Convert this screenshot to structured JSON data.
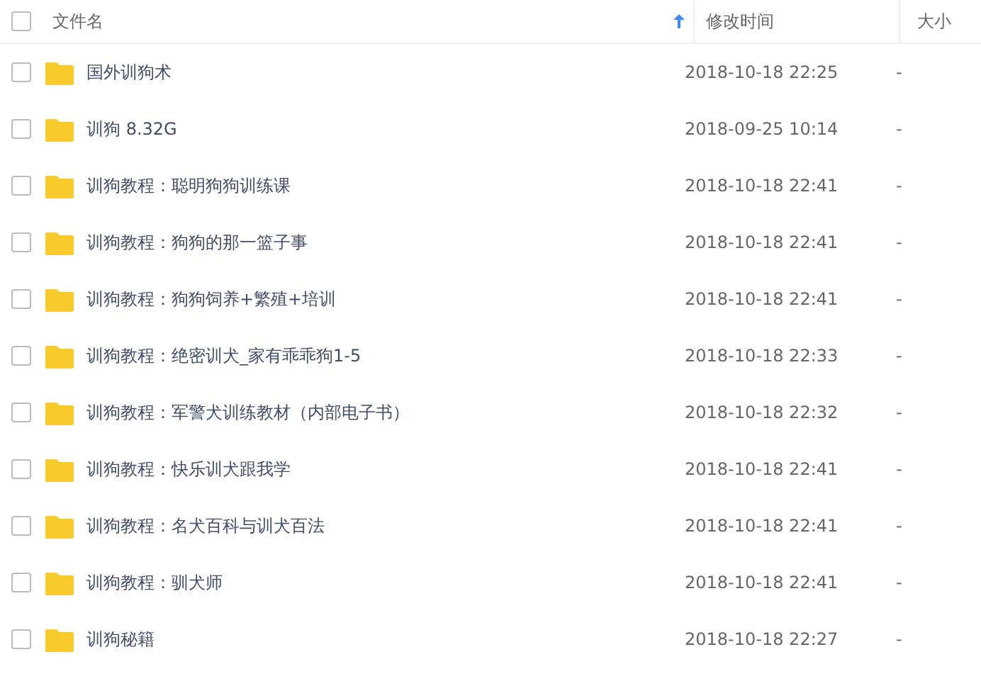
{
  "table": {
    "select_all": {
      "checked": false
    },
    "columns": [
      {
        "label": "文件名",
        "sorted_ascending": true
      },
      {
        "label": "修改时间"
      },
      {
        "label": "大小"
      }
    ],
    "rows": [
      {
        "checked": false,
        "kind": "folder",
        "name": "国外训狗术",
        "modified": "2018-10-18 22:25",
        "size": "-"
      },
      {
        "checked": false,
        "kind": "folder",
        "name": "训狗 8.32G",
        "modified": "2018-09-25 10:14",
        "size": "-"
      },
      {
        "checked": false,
        "kind": "folder",
        "name": "训狗教程：聪明狗狗训练课",
        "modified": "2018-10-18 22:41",
        "size": "-"
      },
      {
        "checked": false,
        "kind": "folder",
        "name": "训狗教程：狗狗的那一篮子事",
        "modified": "2018-10-18 22:41",
        "size": "-"
      },
      {
        "checked": false,
        "kind": "folder",
        "name": "训狗教程：狗狗饲养+繁殖+培训",
        "modified": "2018-10-18 22:41",
        "size": "-"
      },
      {
        "checked": false,
        "kind": "folder",
        "name": "训狗教程：绝密训犬_家有乖乖狗1-5",
        "modified": "2018-10-18 22:33",
        "size": "-"
      },
      {
        "checked": false,
        "kind": "folder",
        "name": "训狗教程：军警犬训练教材（内部电子书）",
        "modified": "2018-10-18 22:32",
        "size": "-"
      },
      {
        "checked": false,
        "kind": "folder",
        "name": "训狗教程：快乐训犬跟我学",
        "modified": "2018-10-18 22:41",
        "size": "-"
      },
      {
        "checked": false,
        "kind": "folder",
        "name": "训狗教程：名犬百科与训犬百法",
        "modified": "2018-10-18 22:41",
        "size": "-"
      },
      {
        "checked": false,
        "kind": "folder",
        "name": "训狗教程：驯犬师",
        "modified": "2018-10-18 22:41",
        "size": "-"
      },
      {
        "checked": false,
        "kind": "folder",
        "name": "训狗秘籍",
        "modified": "2018-10-18 22:27",
        "size": "-"
      }
    ]
  }
}
